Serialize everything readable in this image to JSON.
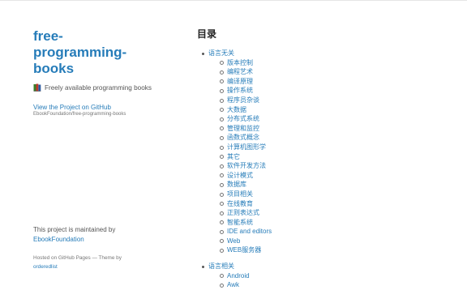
{
  "sidebar": {
    "title_lines": [
      "free-",
      "programming-",
      "books"
    ],
    "tagline": "Freely available programming books",
    "github_link": "View the Project on GitHub",
    "github_repo": "EbookFoundation/free-programming-books",
    "maintained_text": "This project is maintained by",
    "maintainer": "EbookFoundation",
    "hosted_text": "Hosted on GitHub Pages — Theme by",
    "theme_author": "orderedlist"
  },
  "main": {
    "toc_heading": "目录",
    "sections": [
      {
        "label": "语言无关",
        "items": [
          "版本控制",
          "编程艺术",
          "编译原理",
          "操作系统",
          "程序员杂谈",
          "大数据",
          "分布式系统",
          "管理和监控",
          "函数式概念",
          "计算机图形学",
          "其它",
          "软件开发方法",
          "设计模式",
          "数据库",
          "项目相关",
          "在线教育",
          "正则表达式",
          "智能系统",
          "IDE and editors",
          "Web",
          "WEB服务器"
        ]
      },
      {
        "label": "语言相关",
        "items": [
          "Android",
          "Awk"
        ]
      }
    ]
  },
  "colors": {
    "link": "#267cb9",
    "text": "#555555",
    "heading": "#222222"
  },
  "icons": {
    "tagline": "books-icon"
  }
}
